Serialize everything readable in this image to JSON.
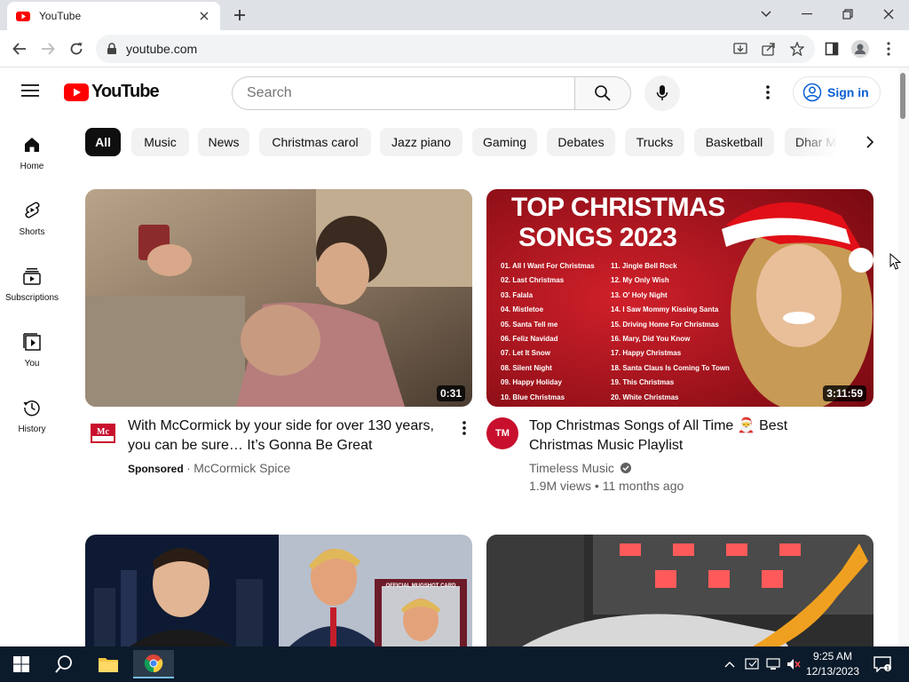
{
  "browser": {
    "tab_title": "YouTube",
    "url": "youtube.com"
  },
  "header": {
    "logo_text": "YouTube",
    "search_placeholder": "Search",
    "signin_label": "Sign in"
  },
  "sidebar": {
    "items": [
      {
        "label": "Home",
        "icon": "home-icon"
      },
      {
        "label": "Shorts",
        "icon": "shorts-icon"
      },
      {
        "label": "Subscriptions",
        "icon": "subscriptions-icon"
      },
      {
        "label": "You",
        "icon": "you-icon"
      },
      {
        "label": "History",
        "icon": "history-icon"
      }
    ]
  },
  "chips": [
    "All",
    "Music",
    "News",
    "Christmas carol",
    "Jazz piano",
    "Gaming",
    "Debates",
    "Trucks",
    "Basketball",
    "Dhar M"
  ],
  "videos": [
    {
      "title_line1": "With McCormick by your side for over 130 years,",
      "title_line2": "you can be sure… It’s Gonna Be Great",
      "sponsored": "Sponsored",
      "separator": "·",
      "channel": "McCormick Spice",
      "duration": "0:31",
      "avatar_text": "McCormick"
    },
    {
      "title_line1": "Top Christmas Songs of All Time 🎅 Best",
      "title_line2": "Christmas Music Playlist",
      "channel": "Timeless Music",
      "views_age": "1.9M views • 11 months ago",
      "duration": "3:11:59",
      "avatar_text": "TM",
      "thumb_heading1": "TOP CHRISTMAS",
      "thumb_heading2": "SONGS 2023",
      "tracklist_left": [
        "01. All I Want For Christmas",
        "02. Last Christmas",
        "03. Falala",
        "04. Mistletoe",
        "05. Santa Tell me",
        "06. Feliz Navidad",
        "07. Let It Snow",
        "08. Silent Night",
        "09. Happy Holiday",
        "10. Blue Christmas"
      ],
      "tracklist_right": [
        "11. Jingle Bell Rock",
        "12. My Only Wish",
        "13. O' Holy Night",
        "14. I Saw Mommy Kissing Santa",
        "15. Driving Home For Christmas",
        "16. Mary, Did You Know",
        "17. Happy Christmas",
        "18. Santa Claus Is Coming To Town",
        "19. This Christmas",
        "20. White Christmas"
      ]
    },
    {
      "thumb_card_text": "OFFICIAL MUGSHOT CARD"
    },
    {}
  ],
  "taskbar": {
    "time": "9:25 AM",
    "date": "12/13/2023"
  },
  "colors": {
    "yt_red": "#ff0000",
    "link_blue": "#065fd4",
    "taskbar_bg": "#0b1b2b"
  }
}
